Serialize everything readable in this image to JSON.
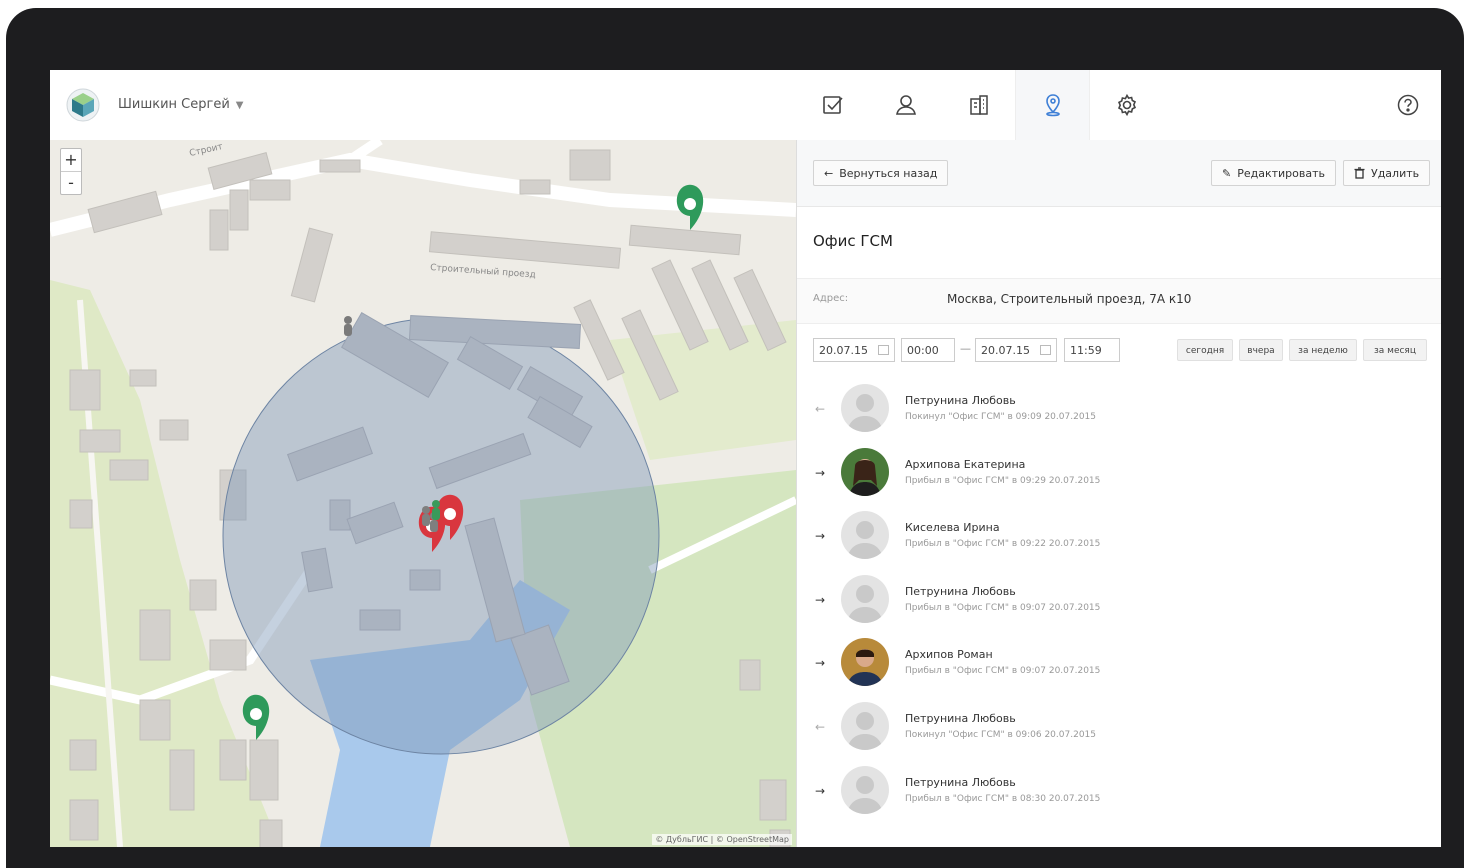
{
  "header": {
    "user_name": "Шишкин Сергей",
    "nav_icons": [
      "tasks-icon",
      "user-icon",
      "building-icon",
      "location-icon",
      "gear-icon"
    ],
    "active_tab": "location-icon",
    "help_icon": "help-icon"
  },
  "map": {
    "zoom_in": "+",
    "zoom_out": "-",
    "street_label_1": "Строительный проезд",
    "street_label_2": "Строит",
    "attribution": "© ДубльГИС | © OpenStreetMap",
    "accent_green": "#2e9a5b",
    "accent_red": "#d9363e",
    "zone_color": "#7f99b8"
  },
  "toolbar": {
    "back_label": "Вернуться назад",
    "edit_label": "Редактировать",
    "delete_label": "Удалить"
  },
  "location": {
    "title": "Офис ГСМ",
    "address_label": "Адрес:",
    "address_value": "Москва, Строительный проезд, 7А к10"
  },
  "filter": {
    "date_from": "20.07.15",
    "time_from": "00:00",
    "date_to": "20.07.15",
    "time_to": "11:59",
    "quick": [
      "сегодня",
      "вчера",
      "за неделю",
      "за месяц"
    ]
  },
  "events": [
    {
      "direction": "out",
      "name": "Петрунина Любовь",
      "detail": "Покинул \"Офис ГСМ\" в 09:09 20.07.2015"
    },
    {
      "direction": "in",
      "name": "Архипова Екатерина",
      "detail": "Прибыл в \"Офис ГСМ\" в 09:29 20.07.2015"
    },
    {
      "direction": "in",
      "name": "Киселева Ирина",
      "detail": "Прибыл в \"Офис ГСМ\" в 09:22 20.07.2015"
    },
    {
      "direction": "in",
      "name": "Петрунина Любовь",
      "detail": "Прибыл в \"Офис ГСМ\" в 09:07 20.07.2015"
    },
    {
      "direction": "in",
      "name": "Архипов Роман",
      "detail": "Прибыл в \"Офис ГСМ\" в 09:07 20.07.2015"
    },
    {
      "direction": "out",
      "name": "Петрунина Любовь",
      "detail": "Покинул \"Офис ГСМ\" в 09:06 20.07.2015"
    },
    {
      "direction": "in",
      "name": "Петрунина Любовь",
      "detail": "Прибыл в \"Офис ГСМ\" в 08:30 20.07.2015"
    }
  ]
}
